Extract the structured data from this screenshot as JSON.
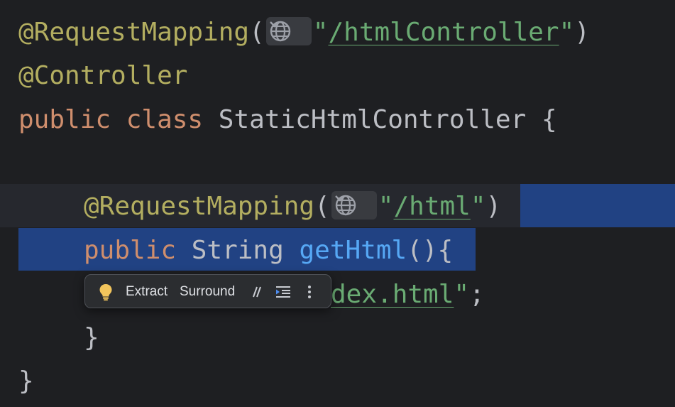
{
  "code": {
    "line1": {
      "annotation": "@RequestMapping",
      "open_paren": "(",
      "quote_open": "\"",
      "path": "/htmlController",
      "quote_close": "\"",
      "close_paren": ")"
    },
    "line2": {
      "annotation": "@Controller"
    },
    "line3": {
      "kw_public": "public",
      "kw_class": "class",
      "class_name": "StaticHtmlController",
      "brace": "{"
    },
    "line5": {
      "annotation": "@RequestMapping",
      "open_paren": "(",
      "quote_open": "\"",
      "path": "/html",
      "quote_close": "\"",
      "close_paren": ")"
    },
    "line6": {
      "kw_public": "public",
      "type": "String",
      "method": "getHtml",
      "parens": "()",
      "brace": "{"
    },
    "line7": {
      "visible_tail": "dex.html",
      "quote_close": "\"",
      "semicolon": ";"
    },
    "line8": {
      "brace": "}"
    },
    "line9": {
      "brace": "}"
    }
  },
  "popup": {
    "extract_label": "Extract",
    "surround_label": "Surround"
  },
  "icons": {
    "bulb": "lightbulb-icon",
    "comment": "comment-icon",
    "reformat": "reformat-icon",
    "more": "more-vertical-icon",
    "globe": "globe-icon",
    "chevron": "chevron-down-icon"
  },
  "colors": {
    "background": "#1e1f22",
    "annotation": "#b3ae60",
    "keyword": "#cf8e6d",
    "string": "#6aab73",
    "method": "#56a8f5",
    "selection": "#214283"
  }
}
